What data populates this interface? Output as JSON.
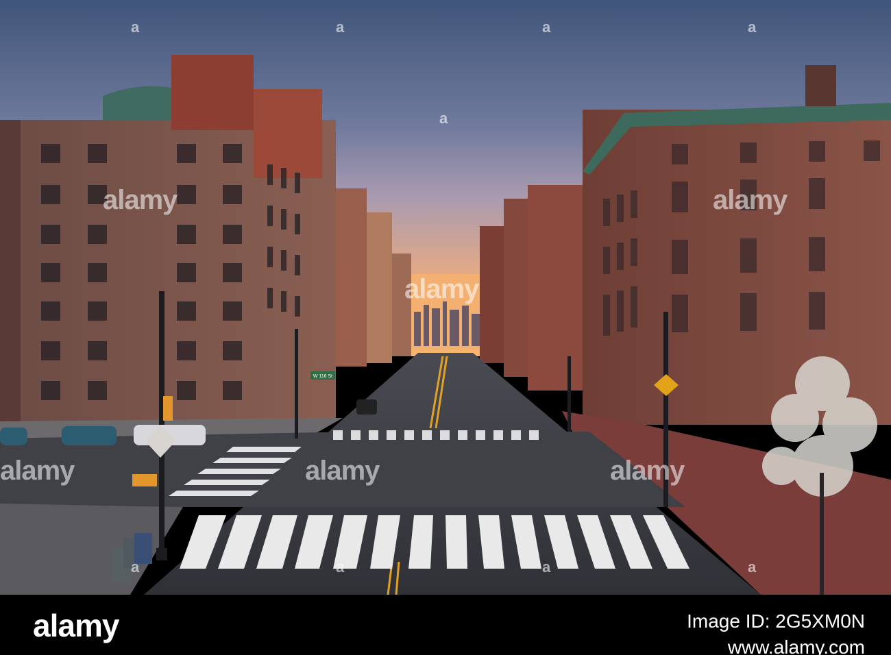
{
  "image": {
    "description_colors": {
      "sky_top": "#4b5f7c",
      "sky_glow": "#f1a46a",
      "brick": "#7a4035",
      "road": "#3d3f45"
    }
  },
  "street_signs": {
    "street_name": "W 116 St"
  },
  "watermark": {
    "logo_text": "alamy",
    "small_mark": "a"
  },
  "footer": {
    "logo_text": "alamy",
    "image_id_label": "Image ID: 2G5XM0N",
    "site_label": "www.alamy.com"
  }
}
